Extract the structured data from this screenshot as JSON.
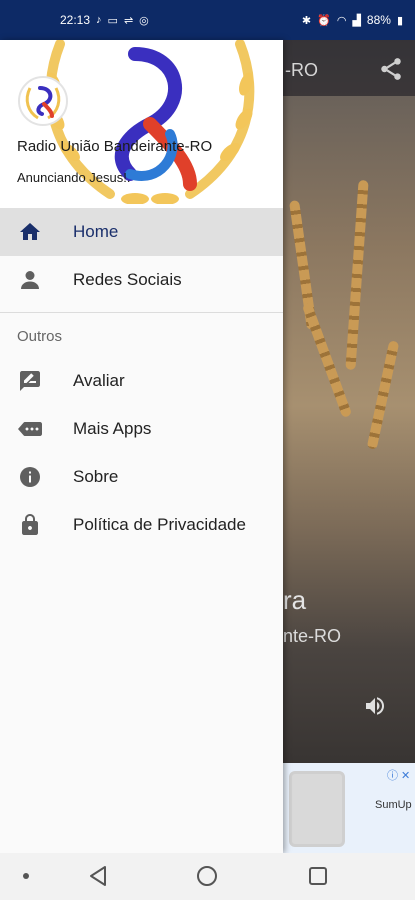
{
  "status_bar": {
    "time": "22:13",
    "battery": "88%",
    "left_icons": [
      "music-note-icon",
      "laptop-icon",
      "usb-icon",
      "whatsapp-icon"
    ],
    "right_icons": [
      "bluetooth-icon",
      "alarm-icon",
      "wifi-icon",
      "signal-icon",
      "battery-icon"
    ]
  },
  "app": {
    "toolbar_title_partial": "-RO",
    "now_playing_title_partial": "ra",
    "now_playing_subtitle_partial": "nte-RO",
    "ad": {
      "text": "SumUp",
      "close": "ⓘ ✕"
    }
  },
  "drawer": {
    "header": {
      "title": "Radio União Bandeirante-RO",
      "subtitle": "Anunciando Jesus!."
    },
    "items": [
      {
        "label": "Home",
        "icon": "home-icon",
        "active": true
      },
      {
        "label": "Redes Sociais",
        "icon": "person-icon",
        "active": false
      }
    ],
    "section_label": "Outros",
    "other_items": [
      {
        "label": "Avaliar",
        "icon": "rate-review-icon"
      },
      {
        "label": "Mais Apps",
        "icon": "more-apps-icon"
      },
      {
        "label": "Sobre",
        "icon": "info-icon"
      },
      {
        "label": "Política de Privacidade",
        "icon": "lock-icon"
      }
    ]
  },
  "colors": {
    "status_bar": "#0d2a66",
    "active_item_bg": "#e0e0e0",
    "accent": "#1a2f6b"
  }
}
